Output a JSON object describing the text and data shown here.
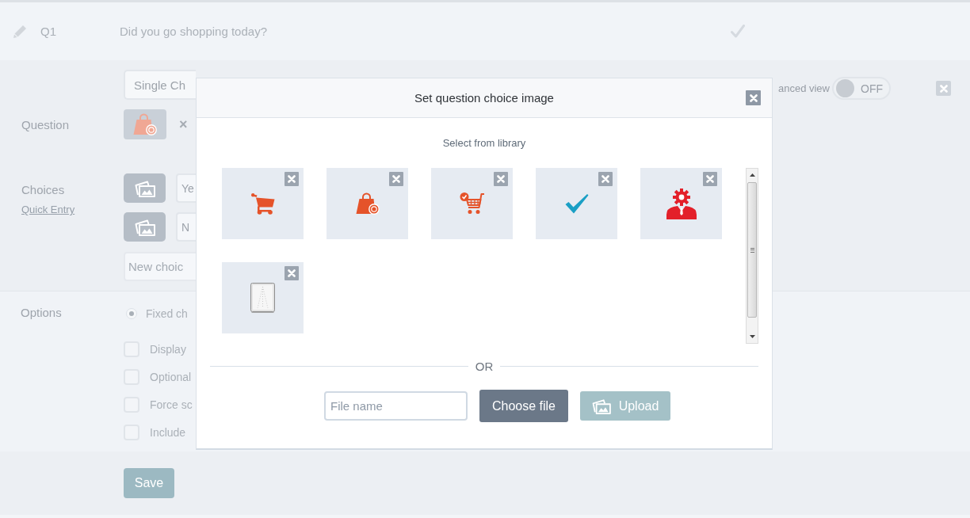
{
  "question_row": {
    "number": "Q1",
    "text": "Did you go shopping today?"
  },
  "editor": {
    "question_type": "Single Ch",
    "advanced_view": {
      "label": "anced view",
      "state_text": "OFF",
      "on": false
    },
    "question": {
      "label": "Question",
      "image": {
        "kind": "shopping-bag"
      },
      "remove": "×"
    },
    "choices": {
      "label": "Choices",
      "quick_entry": "Quick Entry",
      "items": [
        {
          "text": "Ye"
        },
        {
          "text": "N"
        }
      ],
      "new_choice": {
        "placeholder": "New choic"
      }
    },
    "options": {
      "label": "Options",
      "items": [
        {
          "kind": "radio",
          "label": "Fixed ch",
          "selected": true
        },
        {
          "kind": "checkbox",
          "label": "Display",
          "checked": false
        },
        {
          "kind": "checkbox",
          "label": "Optional",
          "checked": false
        },
        {
          "kind": "checkbox",
          "label": "Force sc",
          "checked": false
        },
        {
          "kind": "checkbox",
          "label": "Include",
          "checked": false
        }
      ]
    },
    "save": "Save"
  },
  "modal": {
    "title": "Set question choice image",
    "library_label": "Select from library",
    "images": [
      {
        "kind": "cart"
      },
      {
        "kind": "shopping-bag"
      },
      {
        "kind": "cart-check"
      },
      {
        "kind": "check"
      },
      {
        "kind": "person-gear"
      },
      {
        "kind": "blank-page"
      }
    ],
    "divider": "OR",
    "file_name": {
      "placeholder": "File name"
    },
    "choose_file": "Choose file",
    "upload": {
      "label": "Upload",
      "disabled": true
    }
  }
}
